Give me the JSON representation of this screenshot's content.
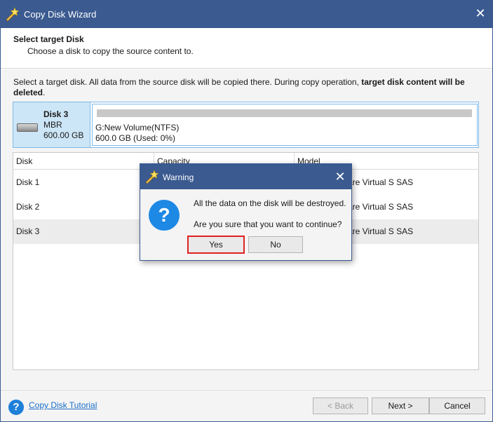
{
  "window": {
    "title": "Copy Disk Wizard",
    "close_symbol": "✕",
    "app_icon": "wizard-wand-icon"
  },
  "header": {
    "title": "Select target Disk",
    "subtitle": "Choose a disk to copy the source content to."
  },
  "notice": {
    "text": "Select a target disk. All data from the source disk will be copied there. During copy operation, ",
    "bold": "target disk content will be deleted",
    "end": "."
  },
  "selected_disk": {
    "name": "Disk 3",
    "type": "MBR",
    "size": "600.00 GB",
    "partition_name": "G:New Volume(NTFS)",
    "partition_info": "600.0 GB (Used: 0%)",
    "used_fraction": 0
  },
  "table": {
    "columns": [
      "Disk",
      "Capacity",
      "Model"
    ],
    "rows": [
      {
        "disk": "Disk 1",
        "model": "are Virtual S SAS"
      },
      {
        "disk": "Disk 2",
        "model": "are Virtual S SAS"
      },
      {
        "disk": "Disk 3",
        "model": "are Virtual S SAS"
      }
    ]
  },
  "footer": {
    "help_symbol": "?",
    "tutorial_label": "Copy Disk Tutorial",
    "back_label": "< Back",
    "next_label": "Next >",
    "cancel_label": "Cancel"
  },
  "dialog": {
    "title": "Warning",
    "close_symbol": "✕",
    "icon_symbol": "?",
    "message1": "All the data on the disk will be destroyed.",
    "message2": "Are you sure that you want to continue?",
    "yes_label": "Yes",
    "no_label": "No"
  },
  "colors": {
    "titlebar": "#3a5a90",
    "selection": "#cde6f7",
    "highlight_border": "#e02020"
  }
}
